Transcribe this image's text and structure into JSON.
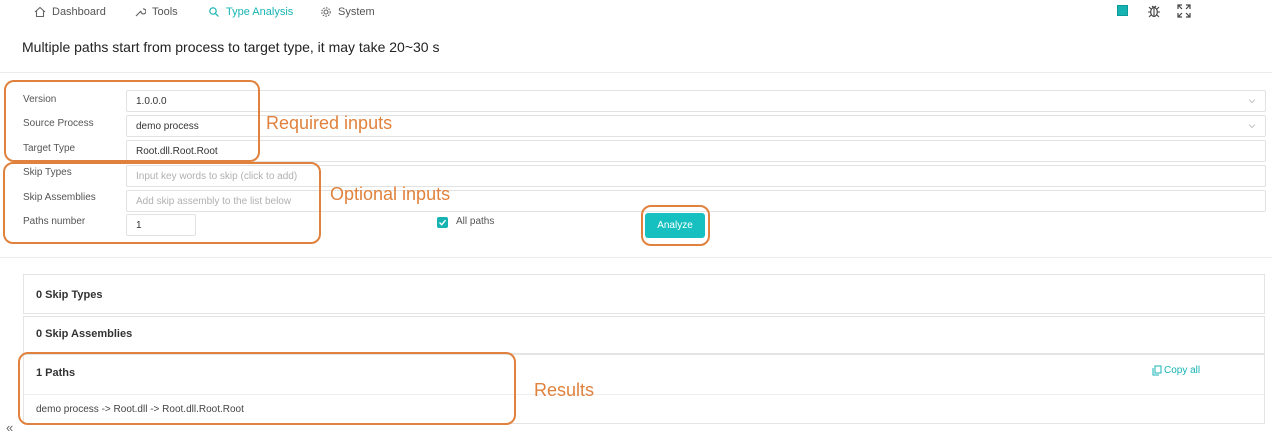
{
  "nav": {
    "items": [
      {
        "label": "Dashboard",
        "icon": "home-icon"
      },
      {
        "label": "Tools",
        "icon": "wrench-icon"
      },
      {
        "label": "Type Analysis",
        "icon": "search-icon"
      },
      {
        "label": "System",
        "icon": "gear-icon"
      }
    ],
    "active": "Type Analysis"
  },
  "page": {
    "title": "Multiple paths start from process to target type, it may take 20~30 s"
  },
  "form": {
    "version": {
      "label": "Version",
      "value": "1.0.0.0"
    },
    "source_process": {
      "label": "Source Process",
      "value": "demo process"
    },
    "target_type": {
      "label": "Target Type",
      "value": "Root.dll.Root.Root"
    },
    "skip_types": {
      "label": "Skip Types",
      "placeholder": "Input key words to skip (click to add)"
    },
    "skip_assemblies": {
      "label": "Skip Assemblies",
      "placeholder": "Add skip assembly to the list below"
    },
    "paths_number": {
      "label": "Paths number",
      "value": "1"
    },
    "all_paths": {
      "label": "All paths",
      "checked": true
    },
    "analyze_label": "Analyze"
  },
  "annotations": {
    "required": "Required inputs",
    "optional": "Optional inputs",
    "results": "Results"
  },
  "results": {
    "skip_types_header": "0 Skip Types",
    "skip_assemblies_header": "0 Skip Assemblies",
    "paths_header": "1 Paths",
    "copy_all": "Copy all",
    "paths": [
      "demo process -> Root.dll -> Root.dll.Root.Root"
    ]
  },
  "colors": {
    "accent": "#17b3b3",
    "annotation": "#e0823d"
  }
}
